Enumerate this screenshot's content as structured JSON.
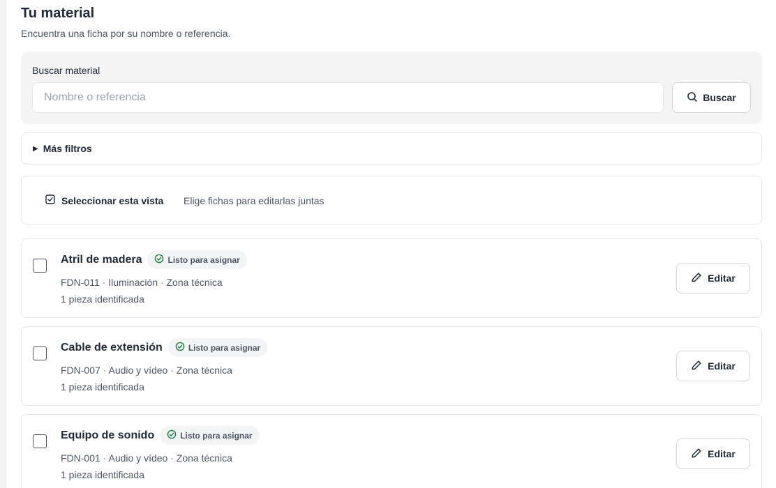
{
  "header": {
    "title": "Tu material",
    "subtitle": "Encuentra una ficha por su nombre o referencia."
  },
  "search": {
    "label": "Buscar material",
    "placeholder": "Nombre o referencia",
    "value": "",
    "button_label": "Buscar",
    "button_icon": "search-icon"
  },
  "filters": {
    "label": "Más filtros",
    "icon": "triangle-right-icon"
  },
  "selection": {
    "label": "Seleccionar esta vista",
    "hint": "Elige fichas para editarlas juntas",
    "icon": "checkbox-checked-icon"
  },
  "colors": {
    "badge_check": "#15803d",
    "text_primary": "#1f2937",
    "text_secondary": "#4b5563"
  },
  "items": [
    {
      "name": "Atril de madera",
      "status": "Listo para asignar",
      "ref": "FDN-011",
      "category": "Iluminación",
      "zone": "Zona técnica",
      "sep1": "·",
      "sep2": "·",
      "pieces": "1 pieza identificada",
      "edit_label": "Editar",
      "checked": false
    },
    {
      "name": "Cable de extensión",
      "status": "Listo para asignar",
      "ref": "FDN-007",
      "category": "Audio y vídeo",
      "zone": "Zona técnica",
      "sep1": "·",
      "sep2": "·",
      "pieces": "1 pieza identificada",
      "edit_label": "Editar",
      "checked": false
    },
    {
      "name": "Equipo de sonido",
      "status": "Listo para asignar",
      "ref": "FDN-001",
      "category": "Audio y vídeo",
      "zone": "Zona técnica",
      "sep1": "·",
      "sep2": "·",
      "pieces": "1 pieza identificada",
      "edit_label": "Editar",
      "checked": false
    }
  ]
}
